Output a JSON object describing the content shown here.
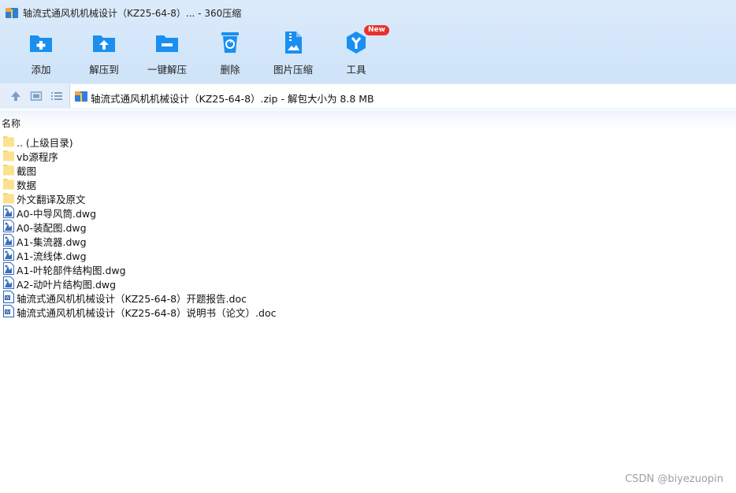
{
  "window": {
    "title": "轴流式通风机机械设计（KZ25-64-8）... - 360压缩"
  },
  "toolbar": {
    "items": [
      {
        "label": "添加",
        "icon": "add-folder-icon"
      },
      {
        "label": "解压到",
        "icon": "extract-to-icon"
      },
      {
        "label": "一键解压",
        "icon": "one-click-extract-icon"
      },
      {
        "label": "删除",
        "icon": "recycle-bin-icon"
      },
      {
        "label": "图片压缩",
        "icon": "image-compress-icon"
      },
      {
        "label": "工具",
        "icon": "tools-icon",
        "badge": "New"
      }
    ]
  },
  "address": {
    "text": "轴流式通风机机械设计（KZ25-64-8）.zip - 解包大小为 8.8 MB"
  },
  "list": {
    "column_name": "名称",
    "rows": [
      {
        "name": ".. (上级目录)",
        "type": "folder"
      },
      {
        "name": "vb源程序",
        "type": "folder"
      },
      {
        "name": "截图",
        "type": "folder"
      },
      {
        "name": "数据",
        "type": "folder"
      },
      {
        "name": "外文翻译及原文",
        "type": "folder"
      },
      {
        "name": "A0-中导风筒.dwg",
        "type": "dwg"
      },
      {
        "name": "A0-装配图.dwg",
        "type": "dwg"
      },
      {
        "name": "A1-集流器.dwg",
        "type": "dwg"
      },
      {
        "name": "A1-流线体.dwg",
        "type": "dwg"
      },
      {
        "name": "A1-叶轮部件结构图.dwg",
        "type": "dwg"
      },
      {
        "name": "A2-动叶片结构图.dwg",
        "type": "dwg"
      },
      {
        "name": "轴流式通风机机械设计（KZ25-64-8）开题报告.doc",
        "type": "doc"
      },
      {
        "name": "轴流式通风机机械设计（KZ25-64-8）说明书（论文）.doc",
        "type": "doc"
      }
    ]
  },
  "watermark": "CSDN @biyezuopin",
  "colors": {
    "accent": "#1a8ff0",
    "folder": "#f7d56b",
    "badge": "#e8322c"
  }
}
